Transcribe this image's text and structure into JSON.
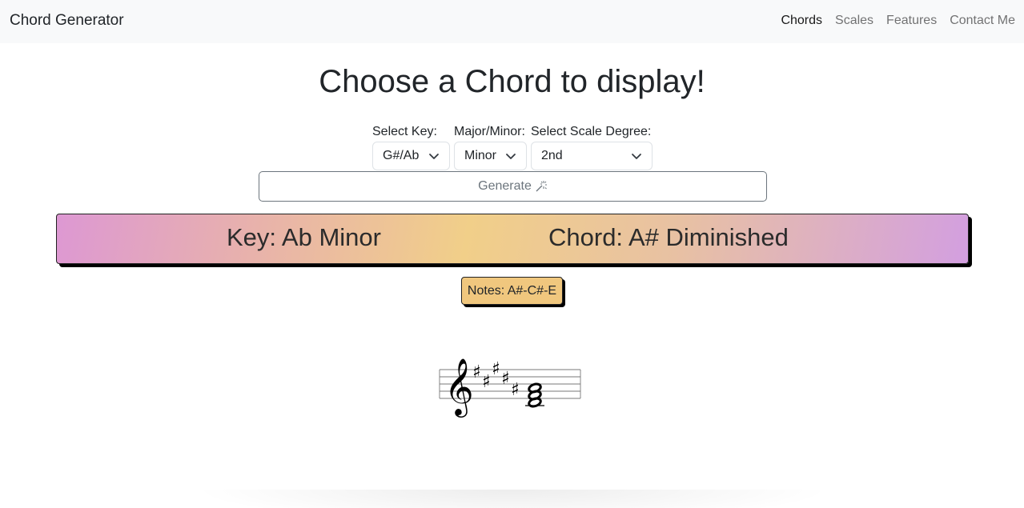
{
  "navbar": {
    "brand": "Chord Generator",
    "links": [
      "Chords",
      "Scales",
      "Features",
      "Contact Me"
    ],
    "active": "Chords"
  },
  "page": {
    "title": "Choose a Chord to display!"
  },
  "form": {
    "key": {
      "label": "Select Key:",
      "value": "G#/Ab"
    },
    "mode": {
      "label": "Major/Minor:",
      "value": "Minor"
    },
    "degree": {
      "label": "Select Scale Degree:",
      "value": "2nd"
    },
    "generate_label": "Generate",
    "generate_icon": "magic-wand-icon"
  },
  "result": {
    "key_text": "Key: Ab Minor",
    "chord_text": "Chord: A# Diminished",
    "notes_text": "Notes: A#-C#-E"
  },
  "colors": {
    "banner_gradient": [
      "#dd98d3",
      "#f1cf89",
      "#d39fe0"
    ],
    "notes_bg": "#f0c77e"
  },
  "notation": {
    "clef": "treble",
    "key_signature_sharps": 5,
    "chord_notes": [
      "A#",
      "C#",
      "E"
    ]
  }
}
